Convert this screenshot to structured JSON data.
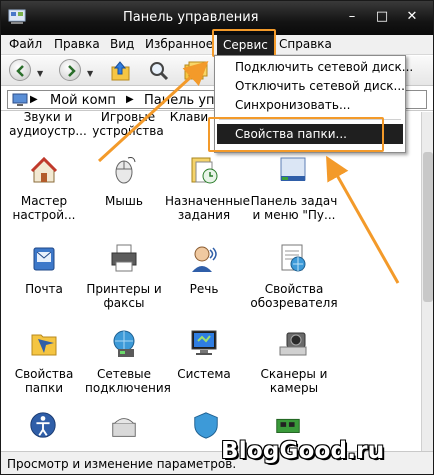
{
  "window": {
    "title": "Панель управления",
    "controls": {
      "minimize": "–",
      "maximize": "□",
      "close": "✕"
    }
  },
  "menubar": {
    "items": [
      {
        "label": "Файл"
      },
      {
        "label": "Правка"
      },
      {
        "label": "Вид"
      },
      {
        "label": "Избранное"
      },
      {
        "label": "Сервис"
      },
      {
        "label": "Справка"
      }
    ],
    "active": "Сервис"
  },
  "address": {
    "segment1": "Мой комп",
    "segment2": "Панель упра"
  },
  "dropdown": {
    "items": [
      {
        "label": "Подключить сетевой диск..."
      },
      {
        "label": "Отключить сетевой диск..."
      },
      {
        "label": "Синхронизовать..."
      },
      {
        "label": "Свойства папки..."
      }
    ],
    "selected": "Свойства папки..."
  },
  "content": {
    "partial_top": [
      {
        "label": "Звуки и аудиоустр..."
      },
      {
        "label": "Игровые устройства"
      },
      {
        "label": "Клави"
      }
    ],
    "items": [
      {
        "label": "Мастер настрой...",
        "icon": "setup-wizard-icon"
      },
      {
        "label": "Мышь",
        "icon": "mouse-icon"
      },
      {
        "label": "Назначенные задания",
        "icon": "scheduled-tasks-icon"
      },
      {
        "label": "Панель задач и меню \"Пу...",
        "icon": "taskbar-icon"
      },
      {
        "label": "Почта",
        "icon": "mail-icon"
      },
      {
        "label": "Принтеры и факсы",
        "icon": "printer-icon"
      },
      {
        "label": "Речь",
        "icon": "speech-icon"
      },
      {
        "label": "Свойства обозревателя",
        "icon": "internet-options-icon"
      },
      {
        "label": "Свойства папки",
        "icon": "folder-options-icon"
      },
      {
        "label": "Сетевые подключения",
        "icon": "network-icon"
      },
      {
        "label": "Система",
        "icon": "system-icon"
      },
      {
        "label": "Сканеры и камеры",
        "icon": "scanner-icon"
      }
    ]
  },
  "statusbar": {
    "text": "Просмотр и изменение параметров."
  },
  "watermark": "BlogGood.ru",
  "colors": {
    "titlebar": "#141414",
    "menu_active": "#1f1f1f",
    "annotation": "#f39a2a"
  }
}
